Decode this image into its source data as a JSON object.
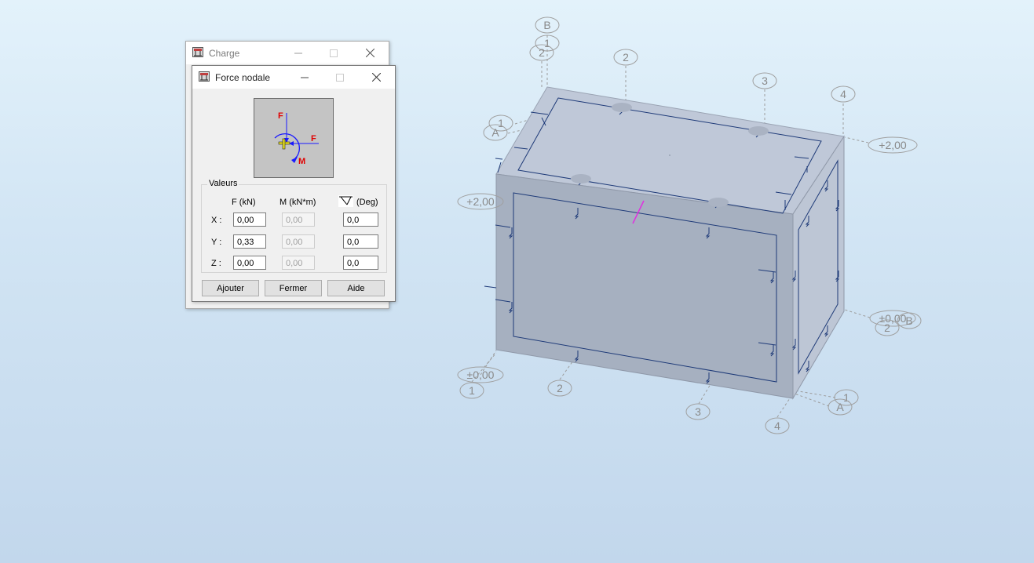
{
  "dialogs": {
    "charge": {
      "title": "Charge"
    },
    "force_nodale": {
      "title": "Force nodale",
      "preview_labels": {
        "force_vertical": "F",
        "force_horizontal": "F",
        "moment": "M"
      },
      "group_label": "Valeurs",
      "columns": {
        "force": "F  (kN)",
        "moment": "M  (kN*m)",
        "angle": "(Deg)"
      },
      "rows": [
        {
          "label": "X :",
          "force": "0,00",
          "moment": "0,00",
          "angle": "0,0"
        },
        {
          "label": "Y :",
          "force": "0,33",
          "moment": "0,00",
          "angle": "0,0"
        },
        {
          "label": "Z :",
          "force": "0,00",
          "moment": "0,00",
          "angle": "0,0"
        }
      ],
      "buttons": {
        "add": "Ajouter",
        "close": "Fermer",
        "help": "Aide"
      }
    }
  },
  "model_view": {
    "grid_bubbles": [
      "B",
      "1",
      "2",
      "2",
      "3",
      "4",
      "1",
      "A",
      "+2,00",
      "+2,00",
      "±0,00",
      "±0,00",
      "B",
      "2",
      "1",
      "2",
      "3",
      "4",
      "1",
      "A"
    ],
    "colors": {
      "box_top": "#bfc8d8",
      "box_front": "#a6b0c0",
      "box_side": "#bec7d6",
      "outline": "#1e3a78",
      "axis": "#a0a0a0",
      "highlight": "#e030e0"
    }
  }
}
